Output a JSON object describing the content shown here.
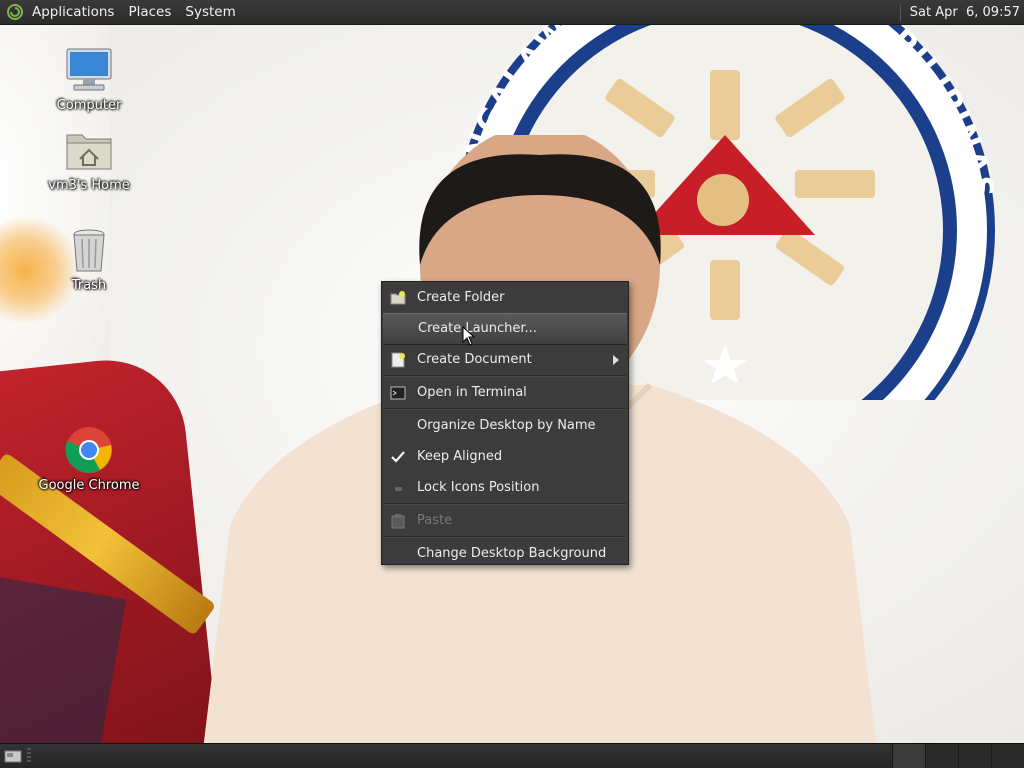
{
  "top_panel": {
    "menus": [
      "Applications",
      "Places",
      "System"
    ],
    "clock": "Sat Apr  6, 09:57"
  },
  "desktop": {
    "icons": [
      {
        "label": "Computer",
        "icon": "computer-icon"
      },
      {
        "label": "vm3's Home",
        "icon": "home-folder-icon"
      },
      {
        "label": "Trash",
        "icon": "trash-icon"
      },
      {
        "label": "Google Chrome",
        "icon": "chrome-icon"
      }
    ],
    "wallpaper": {
      "seal_text": "PANGALAWANG PANGULO NG PILIPINAS"
    }
  },
  "context_menu": {
    "items": [
      {
        "label": "Create Folder",
        "icon": "new-folder-icon",
        "state": "normal"
      },
      {
        "label": "Create Launcher...",
        "icon": "",
        "state": "hover"
      },
      {
        "label": "Create Document",
        "icon": "new-document-icon",
        "state": "normal",
        "submenu": true
      },
      {
        "label": "Open in Terminal",
        "icon": "terminal-icon",
        "state": "normal"
      },
      {
        "label": "Organize Desktop by Name",
        "icon": "",
        "state": "normal"
      },
      {
        "label": "Keep Aligned",
        "icon": "checkmark-icon",
        "state": "checked"
      },
      {
        "label": "Lock Icons Position",
        "icon": "lock-icon",
        "state": "normal"
      },
      {
        "label": "Paste",
        "icon": "paste-icon",
        "state": "disabled"
      },
      {
        "label": "Change Desktop Background",
        "icon": "",
        "state": "normal"
      }
    ]
  },
  "colors": {
    "panel_bg": "#2b2b2b",
    "menu_bg": "#3c3c3c",
    "menu_text": "#ececec",
    "disabled_text": "#777777"
  }
}
